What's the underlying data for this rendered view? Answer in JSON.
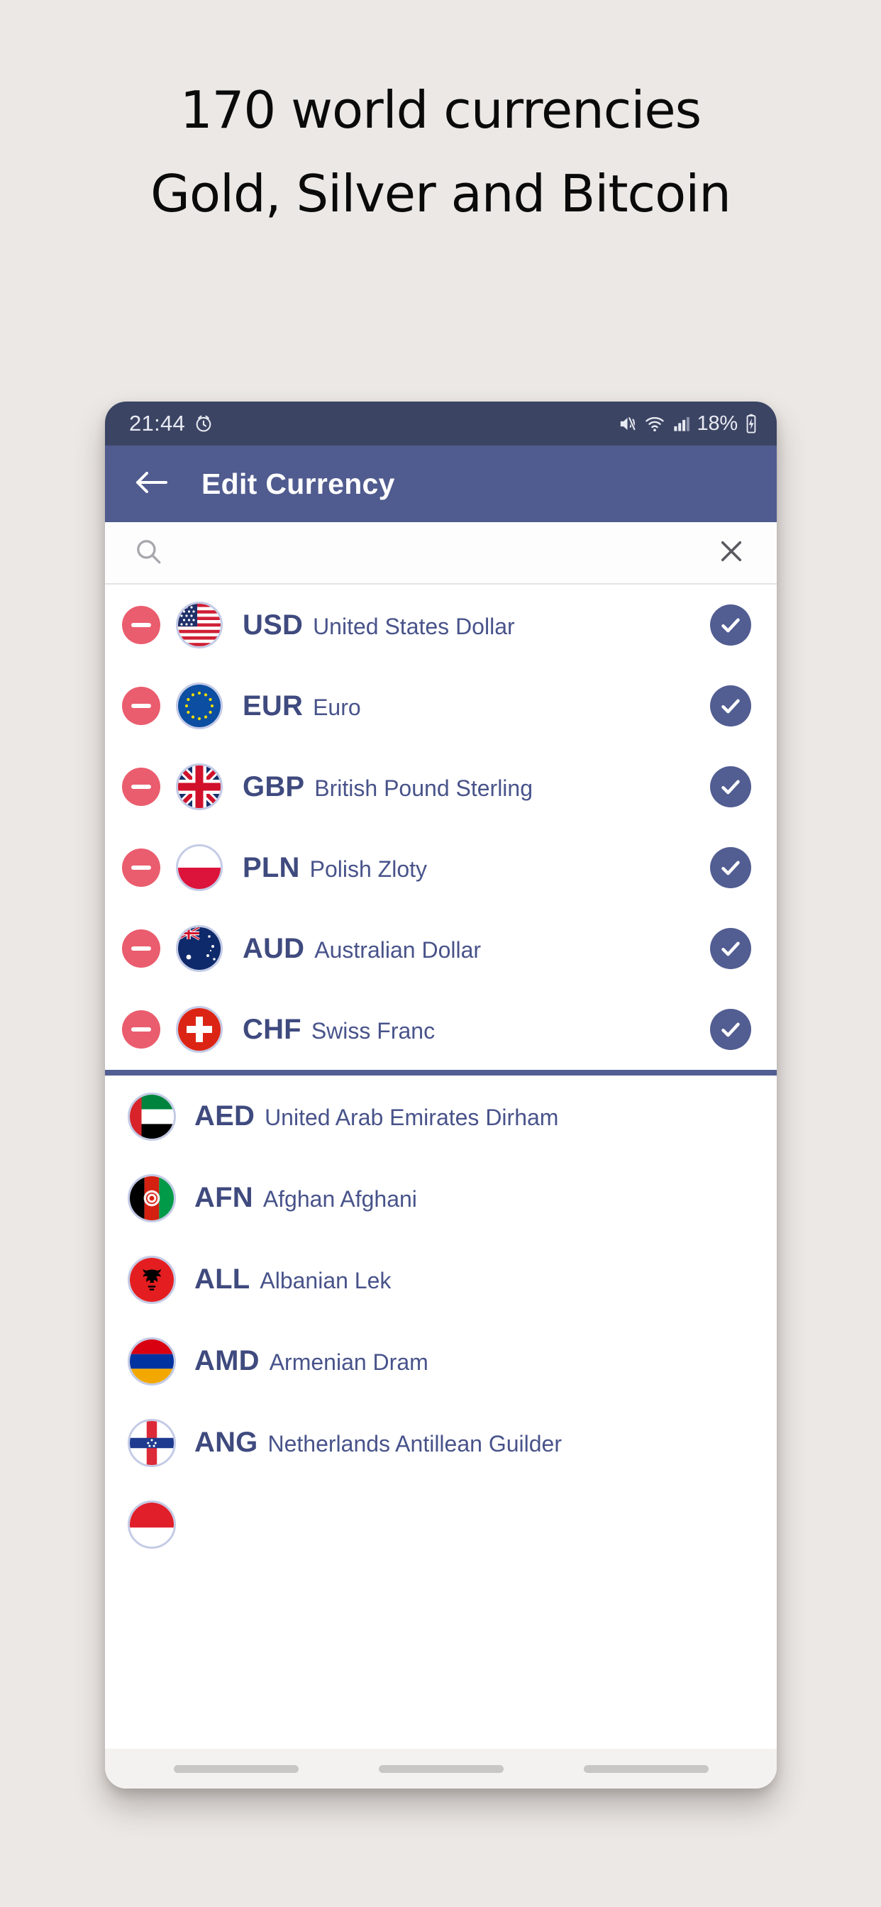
{
  "promo": {
    "line1": "170 world currencies",
    "line2": "Gold, Silver and Bitcoin"
  },
  "colors": {
    "background": "#ece8e5",
    "appbar": "#505b8f",
    "statusbar": "#3b4463",
    "accent_blue": "#525d92",
    "remove_red": "#ea5d6e",
    "code_text": "#3f4a7e",
    "name_text": "#48538a"
  },
  "status_bar": {
    "time": "21:44",
    "alarm_icon": "alarm-icon",
    "mute_icon": "volume-mute-icon",
    "wifi_icon": "wifi-icon",
    "signal_icon": "cellular-signal-icon",
    "battery_percent": "18%",
    "battery_icon": "battery-charging-icon"
  },
  "app_bar": {
    "back_icon": "back-arrow-icon",
    "title": "Edit Currency"
  },
  "search": {
    "icon": "search-icon",
    "value": "",
    "placeholder": "",
    "clear_icon": "close-icon"
  },
  "selected_currencies": [
    {
      "code": "USD",
      "name": "United States Dollar",
      "flag": "us",
      "remove_icon": "minus-circle-icon",
      "check_icon": "check-circle-icon"
    },
    {
      "code": "EUR",
      "name": "Euro",
      "flag": "eu",
      "remove_icon": "minus-circle-icon",
      "check_icon": "check-circle-icon"
    },
    {
      "code": "GBP",
      "name": "British Pound Sterling",
      "flag": "gb",
      "remove_icon": "minus-circle-icon",
      "check_icon": "check-circle-icon"
    },
    {
      "code": "PLN",
      "name": "Polish Zloty",
      "flag": "pl",
      "remove_icon": "minus-circle-icon",
      "check_icon": "check-circle-icon"
    },
    {
      "code": "AUD",
      "name": "Australian Dollar",
      "flag": "au",
      "remove_icon": "minus-circle-icon",
      "check_icon": "check-circle-icon"
    },
    {
      "code": "CHF",
      "name": "Swiss Franc",
      "flag": "ch",
      "remove_icon": "minus-circle-icon",
      "check_icon": "check-circle-icon"
    }
  ],
  "available_currencies": [
    {
      "code": "AED",
      "name": "United Arab Emirates Dirham",
      "flag": "ae"
    },
    {
      "code": "AFN",
      "name": "Afghan Afghani",
      "flag": "af"
    },
    {
      "code": "ALL",
      "name": "Albanian Lek",
      "flag": "al"
    },
    {
      "code": "AMD",
      "name": "Armenian Dram",
      "flag": "am"
    },
    {
      "code": "ANG",
      "name": "Netherlands Antillean Guilder",
      "flag": "an"
    }
  ],
  "nav_bar": {
    "recents_label": "recents-pill",
    "home_label": "home-pill",
    "back_label": "back-pill"
  }
}
